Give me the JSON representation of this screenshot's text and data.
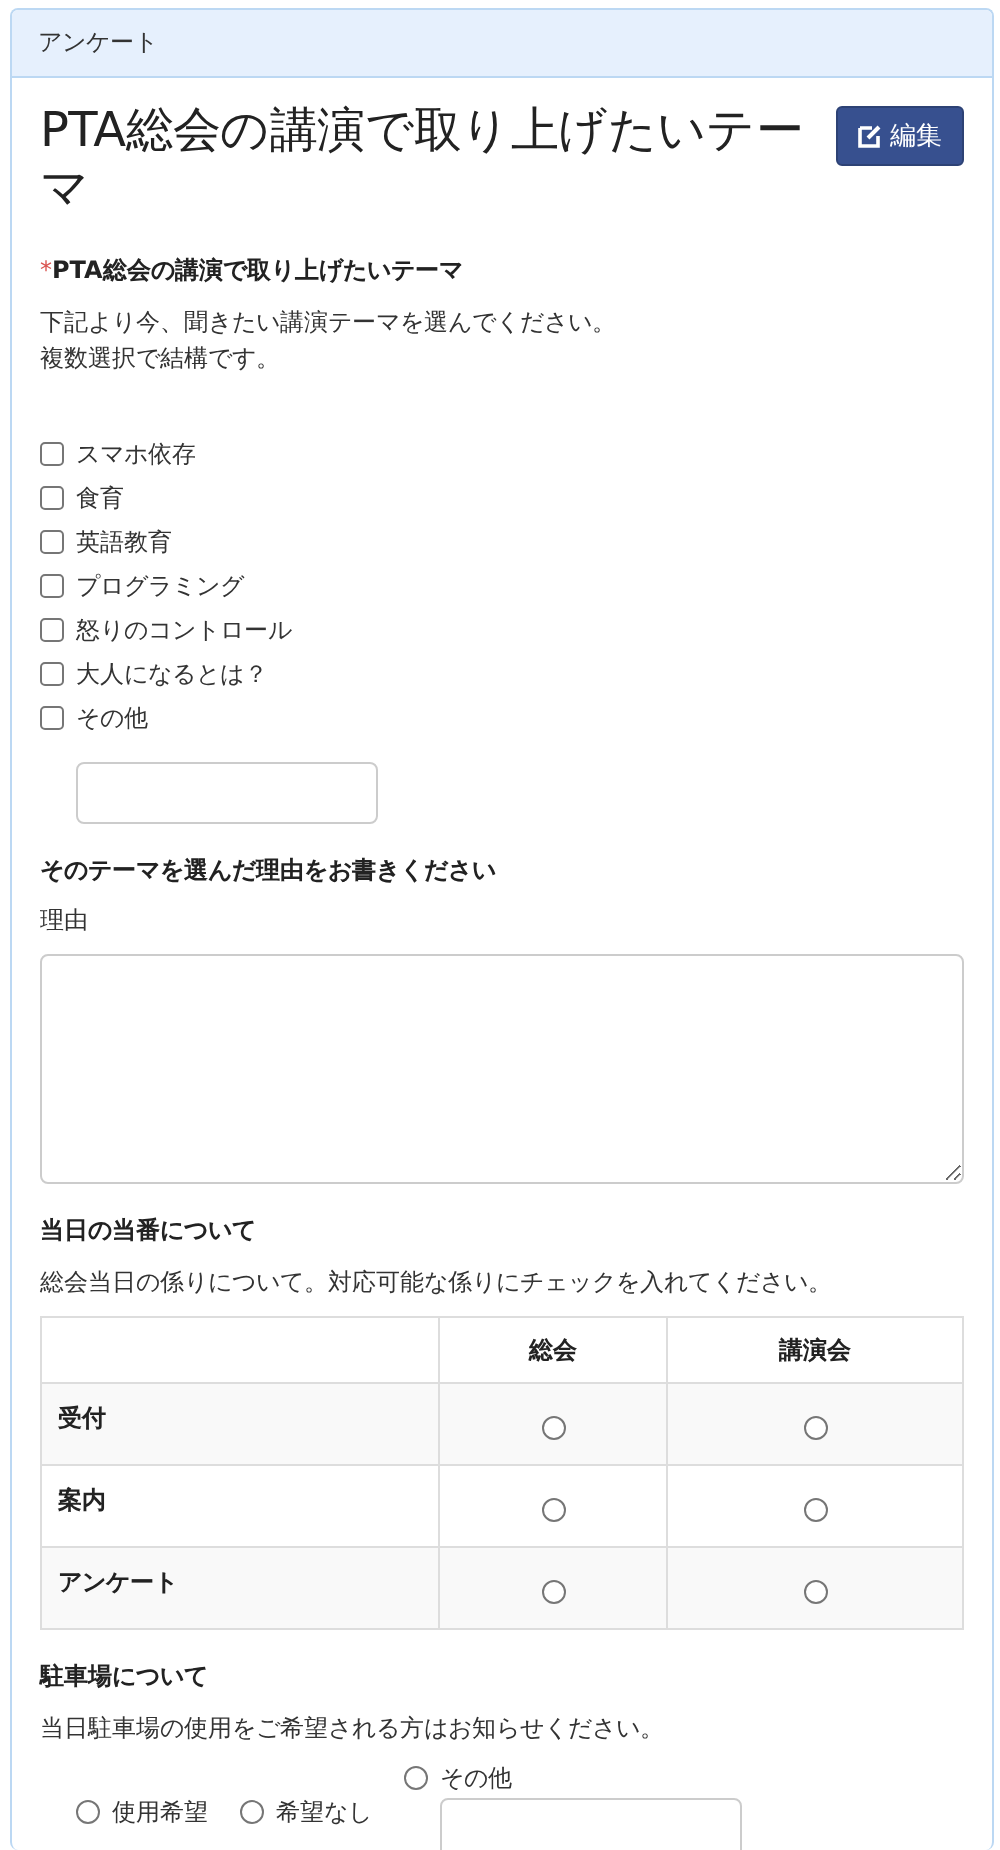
{
  "panel": {
    "title": "アンケート"
  },
  "heading": "PTA総会の講演で取り上げたいテーマ",
  "edit_button": "編集",
  "questions": [
    {
      "kind": "checkboxes",
      "required": true,
      "required_mark": "*",
      "label": "PTA総会の講演で取り上げたいテーマ",
      "description": [
        "下記より今、聞きたい講演テーマを選んでください。",
        "複数選択で結構です。"
      ],
      "options": [
        {
          "label": "スマホ依存",
          "checked": false
        },
        {
          "label": "食育",
          "checked": false
        },
        {
          "label": "英語教育",
          "checked": false
        },
        {
          "label": "プログラミング",
          "checked": false
        },
        {
          "label": "怒りのコントロール",
          "checked": false
        },
        {
          "label": "大人になるとは？",
          "checked": false
        },
        {
          "label": "その他",
          "checked": false,
          "has_field": true
        }
      ]
    },
    {
      "kind": "textarea",
      "label": "そのテーマを選んだ理由をお書きください",
      "field_label": "理由"
    },
    {
      "kind": "matrix",
      "label": "当日の当番について",
      "description": [
        "総会当日の係りについて。対応可能な係りにチェックを入れてください。"
      ],
      "columns": [
        "総会",
        "講演会"
      ],
      "rows": [
        {
          "label": "受付",
          "choices": [
            {
              "selected": false
            },
            {
              "selected": false
            }
          ]
        },
        {
          "label": "案内",
          "choices": [
            {
              "selected": false
            },
            {
              "selected": false
            }
          ]
        },
        {
          "label": "アンケート",
          "choices": [
            {
              "selected": false
            },
            {
              "selected": false
            }
          ]
        }
      ]
    },
    {
      "kind": "radios",
      "label": "駐車場について",
      "description": [
        "当日駐車場の使用をご希望される方はお知らせください。"
      ],
      "options": [
        {
          "label": "使用希望",
          "selected": false
        },
        {
          "label": "希望なし",
          "selected": false
        },
        {
          "label": "その他",
          "selected": false,
          "has_field": true
        }
      ]
    }
  ]
}
